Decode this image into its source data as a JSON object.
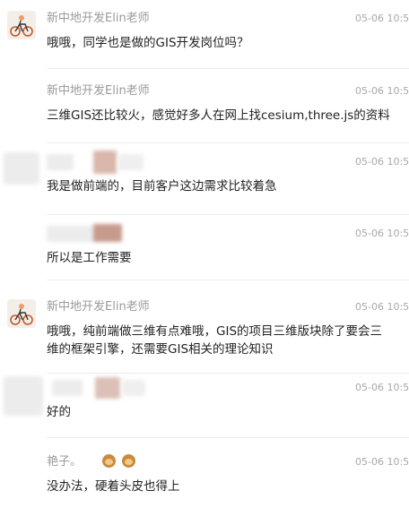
{
  "comments": [
    {
      "author": "新中地开发Elin老师",
      "time": "05-06 10:53",
      "text": "哦哦，同学也是做的GIS开发岗位吗？",
      "avatar": "teacher-avatar"
    },
    {
      "author": "新中地开发Elin老师",
      "time": "05-06 10:53",
      "text": "三维GIS还比较火，感觉好多人在网上找cesium,three.js的资料"
    },
    {
      "author": "",
      "time": "05-06 10:54",
      "text": "我是做前端的，目前客户这边需求比较着急",
      "avatar": "blurred-avatar"
    },
    {
      "author": "",
      "time": "05-06 10:54",
      "text": "所以是工作需要"
    },
    {
      "author": "新中地开发Elin老师",
      "time": "05-06 10:56",
      "text_lines": [
        "哦哦，纯前端做三维有点难哦，GIS的项目三维版块除了要会三",
        "维的框架引擎，还需要GIS相关的理论知识"
      ],
      "avatar": "teacher-avatar"
    },
    {
      "author": "",
      "time": "05-06 10:56",
      "text": "好的",
      "avatar": "blurred-avatar"
    },
    {
      "author": "艳子。",
      "time": "05-06 10:57",
      "text": "没办法，硬着头皮也得上",
      "emoji": "monkey-emoji"
    }
  ],
  "colors": {
    "name": "#9a9a9a",
    "time": "#a8a8a8",
    "text": "#222222",
    "divider": "#ededed"
  }
}
